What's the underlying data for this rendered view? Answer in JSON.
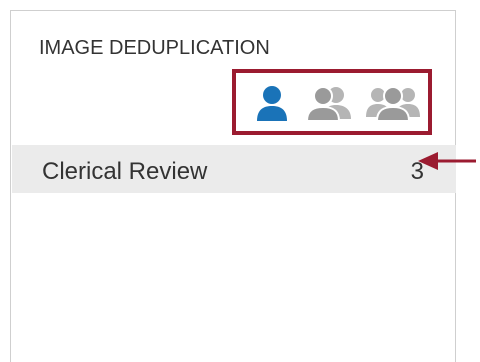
{
  "panel": {
    "title": "IMAGE DEDUPLICATION",
    "icons": [
      {
        "name": "single-user-icon",
        "color": "#1a73b8",
        "selected": true
      },
      {
        "name": "two-users-icon",
        "color": "#9a9a9a",
        "selected": false
      },
      {
        "name": "user-group-icon",
        "color": "#9a9a9a",
        "selected": false
      }
    ],
    "highlight_color": "#9b1b30",
    "rows": [
      {
        "label": "Clerical Review",
        "count": "3"
      }
    ]
  },
  "annotation": {
    "arrow_color": "#9b1b30"
  }
}
